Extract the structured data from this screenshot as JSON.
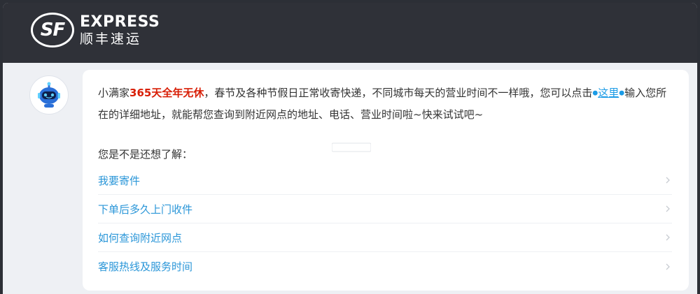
{
  "header": {
    "logo_mark": "SF",
    "logo_en": "EXPRESS",
    "logo_cn": "顺丰速运"
  },
  "message": {
    "part1": "小满家",
    "highlight": "365天全年无休",
    "part2": "，春节及各种节假日正常收寄快递，不同城市每天的营业时间不一样哦，您可以点击",
    "link": "这里",
    "part3": "输入您所在的详细地址，就能帮您查询到附近网点的地址、电话、营业时间啦~快来试试吧~"
  },
  "prompt": "您是不是还想了解：",
  "suggestions": [
    {
      "label": "我要寄件"
    },
    {
      "label": "下单后多久上门收件"
    },
    {
      "label": "如何查询附近网点"
    },
    {
      "label": "客服热线及服务时间"
    }
  ],
  "colors": {
    "header_bg": "#2f3138",
    "highlight": "#d81e06",
    "link": "#1a9be6",
    "suggestion": "#2a96d8"
  },
  "icons": {
    "avatar": "robot-icon",
    "chevron": "chevron-right-icon"
  }
}
